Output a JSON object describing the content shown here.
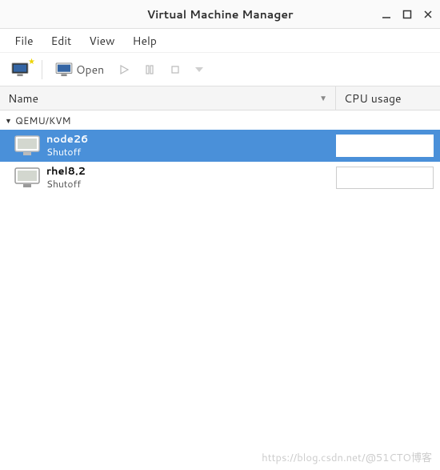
{
  "window": {
    "title": "Virtual Machine Manager"
  },
  "menu": {
    "file": "File",
    "edit": "Edit",
    "view": "View",
    "help": "Help"
  },
  "toolbar": {
    "open_label": "Open"
  },
  "columns": {
    "name": "Name",
    "cpu": "CPU usage"
  },
  "connection": {
    "label": "QEMU/KVM"
  },
  "vms": [
    {
      "name": "node26",
      "status": "Shutoff",
      "selected": true
    },
    {
      "name": "rhel8.2",
      "status": "Shutoff",
      "selected": false
    }
  ],
  "watermark": "https://blog.csdn.net/@51CTO博客"
}
